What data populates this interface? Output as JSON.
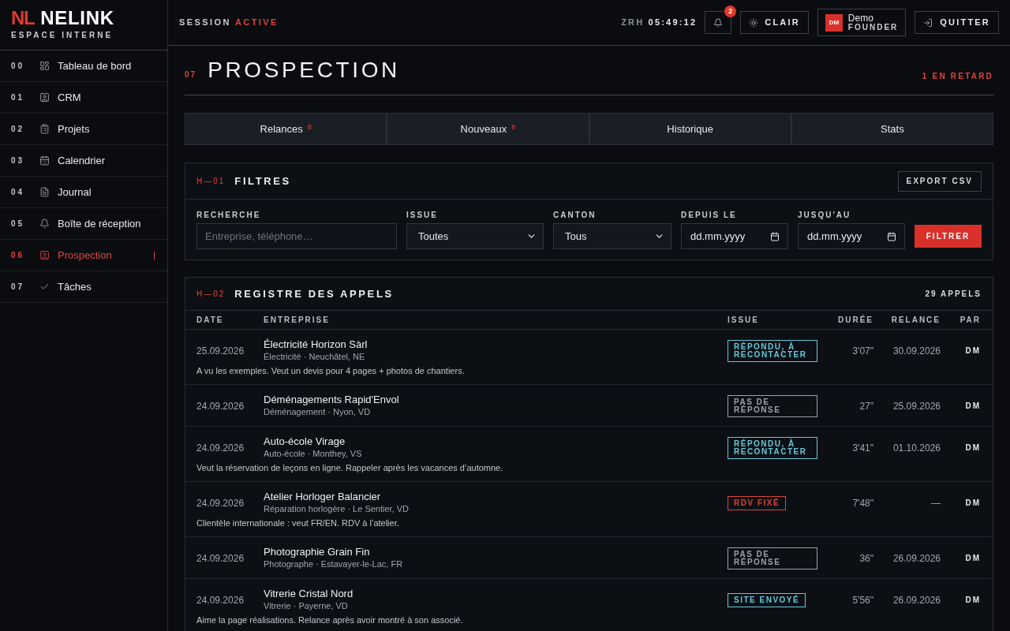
{
  "sidebar": {
    "logo": {
      "mark": "NL",
      "name": "NELINK",
      "subtitle": "ESPACE INTERNE"
    },
    "items": [
      {
        "number": "00",
        "label": "Tableau de bord",
        "selected": false
      },
      {
        "number": "01",
        "label": "CRM",
        "selected": false
      },
      {
        "number": "02",
        "label": "Projets",
        "selected": false
      },
      {
        "number": "03",
        "label": "Calendrier",
        "selected": false
      },
      {
        "number": "04",
        "label": "Journal",
        "selected": false
      },
      {
        "number": "05",
        "label": "Boîte de réception",
        "selected": false
      },
      {
        "number": "06",
        "label": "Prospection",
        "selected": true
      },
      {
        "number": "07",
        "label": "Tâches",
        "selected": false
      }
    ]
  },
  "header": {
    "session_label": "SESSION",
    "session_status": "ACTIVE",
    "timezone": "ZRH",
    "time": "05:49:12",
    "notification_count": "2",
    "theme_button": "CLAIR",
    "user": {
      "initials": "DM",
      "name": "Demo",
      "role": "FOUNDER"
    },
    "quit_button": "QUITTER"
  },
  "page": {
    "number": "07",
    "title": "PROSPECTION",
    "overdue": "1 EN RETARD"
  },
  "tabs": [
    {
      "label": "Relances",
      "count": "8",
      "selected": false
    },
    {
      "label": "Nouveaux",
      "count": "8",
      "selected": false
    },
    {
      "label": "Historique",
      "selected": false
    },
    {
      "label": "Stats",
      "selected": false
    }
  ],
  "filters": {
    "code": "H—01",
    "title": "FILTRES",
    "export_button": "EXPORT CSV",
    "fields": [
      {
        "kind": "text",
        "label": "RECHERCHE",
        "placeholder": "Entreprise, téléphone…"
      },
      {
        "kind": "select",
        "label": "ISSUE",
        "value": "Toutes"
      },
      {
        "kind": "select",
        "label": "CANTON",
        "value": "Tous"
      },
      {
        "kind": "date",
        "label": "DEPUIS LE",
        "placeholder": "dd.mm.yyyy"
      },
      {
        "kind": "date",
        "label": "JUSQU'AU",
        "placeholder": "dd.mm.yyyy"
      }
    ],
    "submit_button": "FILTRER"
  },
  "calls": {
    "code": "H—02",
    "title": "REGISTRE DES APPELS",
    "count": "29 APPELS",
    "columns": [
      "DATE",
      "ENTREPRISE",
      "ISSUE",
      "DURÉE",
      "RELANCE",
      "PAR"
    ],
    "rows": [
      {
        "date": "25.09.2026",
        "company": "Électricité Horizon Sàrl",
        "details": "Électricité · Neuchâtel, NE",
        "note": "A vu les exemples. Veut un devis pour 4 pages + photos de chantiers.",
        "issue": {
          "label": "RÉPONDU, À RECONTACTER",
          "color": "#62c9d9"
        },
        "duration": "3'07\"",
        "follow_up": "30.09.2026",
        "by": "DM"
      },
      {
        "date": "24.09.2026",
        "company": "Déménagements Rapid'Envol",
        "details": "Déménagement · Nyon, VD",
        "issue": {
          "label": "PAS DE RÉPONSE",
          "color": "#9ca1a9"
        },
        "duration": "27\"",
        "follow_up": "25.09.2026",
        "by": "DM"
      },
      {
        "date": "24.09.2026",
        "company": "Auto-école Virage",
        "details": "Auto-école · Monthey, VS",
        "note": "Veut la réservation de leçons en ligne. Rappeler après les vacances d’automne.",
        "issue": {
          "label": "RÉPONDU, À RECONTACTER",
          "color": "#62c9d9"
        },
        "duration": "3'41\"",
        "follow_up": "01.10.2026",
        "by": "DM"
      },
      {
        "date": "24.09.2026",
        "company": "Atelier Horloger Balancier",
        "details": "Réparation horlogère · Le Sentier, VD",
        "note": "Clientèle internationale : veut FR/EN. RDV à l’atelier.",
        "issue": {
          "label": "RDV FIXÉ",
          "color": "#d9453a"
        },
        "duration": "7'48\"",
        "follow_up": "—",
        "by": "DM"
      },
      {
        "date": "24.09.2026",
        "company": "Photographie Grain Fin",
        "details": "Photographe · Estavayer-le-Lac, FR",
        "issue": {
          "label": "PAS DE RÉPONSE",
          "color": "#9ca1a9"
        },
        "duration": "36\"",
        "follow_up": "26.09.2026",
        "by": "DM"
      },
      {
        "date": "24.09.2026",
        "company": "Vitrerie Cristal Nord",
        "details": "Vitrerie · Payerne, VD",
        "note": "Aime la page réalisations. Relance après avoir montré à son associé.",
        "issue": {
          "label": "SITE ENVOYÉ",
          "color": "#62c9d9"
        },
        "duration": "5'56\"",
        "follow_up": "26.09.2026",
        "by": "DM"
      }
    ]
  }
}
